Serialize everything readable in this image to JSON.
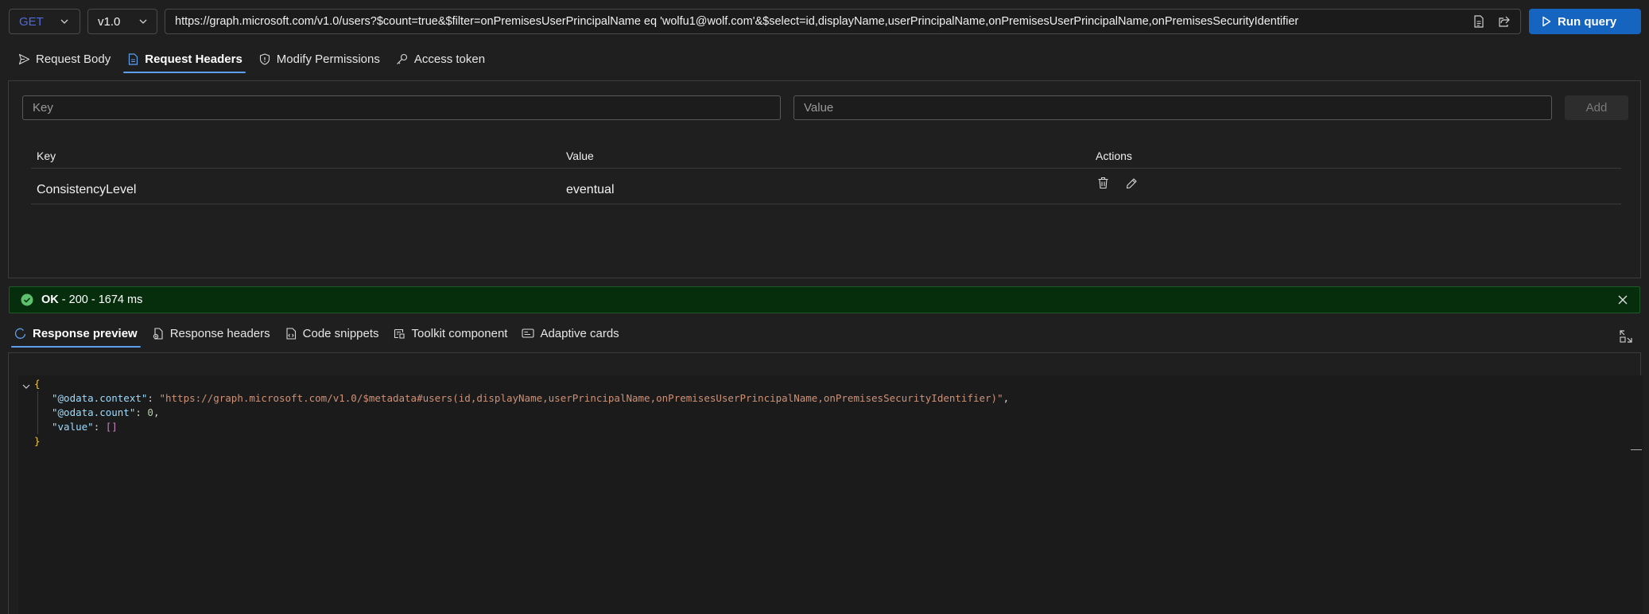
{
  "query": {
    "method": "GET",
    "version": "v1.0",
    "url": "https://graph.microsoft.com/v1.0/users?$count=true&$filter=onPremisesUserPrincipalName eq 'wolfu1@wolf.com'&$select=id,displayName,userPrincipalName,onPremisesUserPrincipalName,onPremisesSecurityIdentifier",
    "run_label": "Run query"
  },
  "request_tabs": [
    {
      "label": "Request Body",
      "icon": "send-icon",
      "active": false
    },
    {
      "label": "Request Headers",
      "icon": "document-icon",
      "active": true
    },
    {
      "label": "Modify Permissions",
      "icon": "shield-icon",
      "active": false
    },
    {
      "label": "Access token",
      "icon": "key-icon",
      "active": false
    }
  ],
  "headers_form": {
    "key_placeholder": "Key",
    "value_placeholder": "Value",
    "add_label": "Add"
  },
  "headers_table": {
    "columns": [
      "Key",
      "Value",
      "Actions"
    ],
    "rows": [
      {
        "key": "ConsistencyLevel",
        "value": "eventual"
      }
    ]
  },
  "status": {
    "ok": "OK",
    "detail": " - 200 - 1674 ms",
    "color": "#062e0d"
  },
  "response_tabs": [
    {
      "label": "Response preview",
      "icon": "preview-icon",
      "active": true
    },
    {
      "label": "Response headers",
      "icon": "headers-icon",
      "active": false
    },
    {
      "label": "Code snippets",
      "icon": "code-icon",
      "active": false
    },
    {
      "label": "Toolkit component",
      "icon": "toolkit-icon",
      "active": false
    },
    {
      "label": "Adaptive cards",
      "icon": "card-icon",
      "active": false
    }
  ],
  "response_json": {
    "open_brace": "{",
    "close_brace": "}",
    "context_key": "\"@odata.context\"",
    "context_value": "\"https://graph.microsoft.com/v1.0/$metadata#users(id,displayName,userPrincipalName,onPremisesUserPrincipalName,onPremisesSecurityIdentifier)\"",
    "count_key": "\"@odata.count\"",
    "count_value": "0",
    "value_key": "\"value\"",
    "value_value": "[]"
  },
  "colors": {
    "accent": "#1564c0",
    "tab_underline": "#5ea0ef",
    "method": "#4f6bd9",
    "success": "#5cc26b"
  }
}
